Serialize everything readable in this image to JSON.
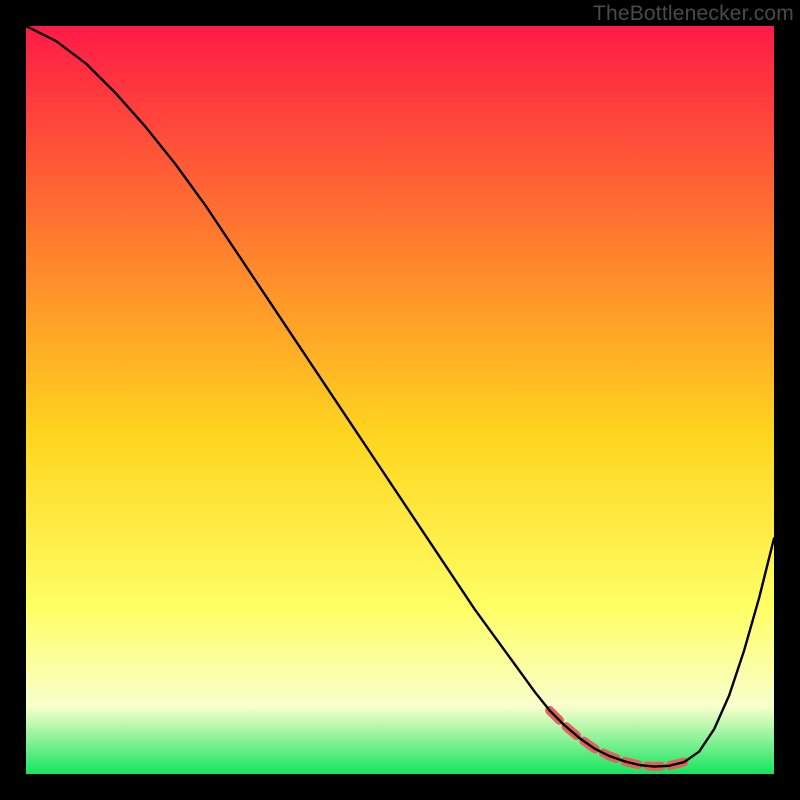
{
  "watermark": "TheBottleneсker.com",
  "colors": {
    "gradient_top": "#ff1a47",
    "gradient_mid1": "#ff7a2e",
    "gradient_mid2": "#ffd61f",
    "gradient_mid3": "#ffff66",
    "gradient_low": "#f8ffcc",
    "gradient_bottom": "#15e55f",
    "curve": "#000000",
    "segment": "#e2635d",
    "frame": "#000000"
  },
  "chart_data": {
    "type": "line",
    "title": "",
    "xlabel": "",
    "ylabel": "",
    "xlim": [
      0,
      100
    ],
    "ylim": [
      0,
      100
    ],
    "series": [
      {
        "name": "bottleneck-curve",
        "x": [
          0,
          4,
          8,
          12,
          16,
          20,
          24,
          28,
          32,
          36,
          40,
          44,
          48,
          52,
          56,
          60,
          64,
          68,
          70,
          72,
          74,
          76,
          78,
          80,
          82,
          84,
          86,
          88,
          90,
          92,
          94,
          96,
          98,
          100
        ],
        "values": [
          100,
          98,
          95,
          91,
          86.5,
          81.5,
          76,
          70,
          64,
          58,
          52,
          46,
          40,
          34,
          28,
          22,
          16.5,
          11,
          8.5,
          6.5,
          4.8,
          3.4,
          2.4,
          1.7,
          1.2,
          1.0,
          1.1,
          1.6,
          3.0,
          6.0,
          10.5,
          16.5,
          23.5,
          31.5
        ]
      },
      {
        "name": "optimal-segment",
        "x": [
          70,
          72,
          74,
          76,
          78,
          80,
          82,
          84,
          86,
          88
        ],
        "values": [
          8.5,
          6.5,
          4.8,
          3.4,
          2.4,
          1.7,
          1.2,
          1.0,
          1.1,
          1.6
        ]
      }
    ]
  }
}
